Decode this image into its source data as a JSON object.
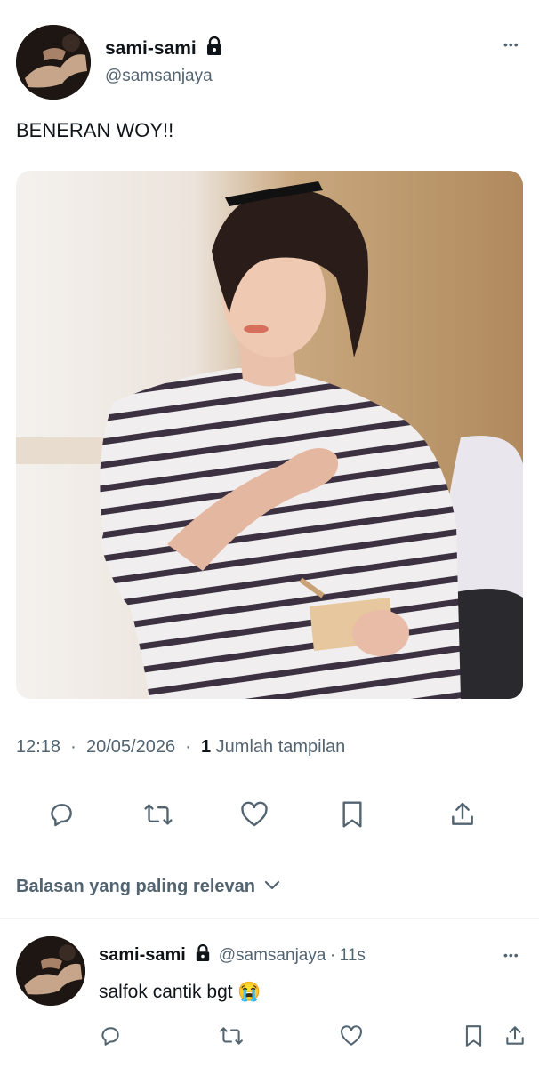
{
  "tweet": {
    "display_name": "sami-sami",
    "handle": "@samsanjaya",
    "text": "BENERAN WOY!!",
    "time": "12:18",
    "date": "20/05/2026",
    "views_count": "1",
    "views_label": "Jumlah tampilan",
    "more_label": "•••"
  },
  "actions": [
    "reply-icon",
    "retweet-icon",
    "like-icon",
    "bookmark-icon",
    "share-icon"
  ],
  "replies_sort": {
    "label": "Balasan yang paling relevan"
  },
  "reply": {
    "display_name": "sami-sami",
    "handle": "@samsanjaya",
    "separator": "·",
    "age": "11s",
    "text": "salfok cantik bgt 😭",
    "more_label": "•••"
  },
  "colors": {
    "primary_text": "#0f1419",
    "secondary_text": "#536471",
    "divider": "#eff3f4"
  }
}
